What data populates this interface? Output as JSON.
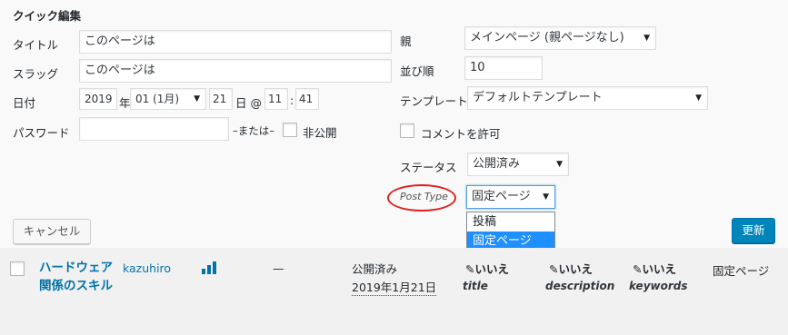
{
  "quick_edit": {
    "heading": "クイック編集",
    "title_label": "タイトル",
    "title_value": "このページは",
    "slug_label": "スラッグ",
    "slug_value": "このページは",
    "date_label": "日付",
    "year": "2019",
    "year_suffix": "年",
    "month": "01 (1月)",
    "day": "21",
    "day_suffix": "日 @",
    "hour": "11",
    "colon": ":",
    "minute": "41",
    "password_label": "パスワード",
    "password_value": "",
    "or_text": "–または–",
    "private_label": "非公開",
    "parent_label": "親",
    "parent_value": "メインページ (親ページなし)",
    "order_label": "並び順",
    "order_value": "10",
    "template_label": "テンプレート",
    "template_value": "デフォルトテンプレート",
    "comments_label": "コメントを許可",
    "status_label": "ステータス",
    "status_value": "公開済み",
    "post_type_label": "Post Type",
    "post_type_value": "固定ページ",
    "post_type_options": [
      "投稿",
      "固定ページ"
    ],
    "cancel_label": "キャンセル",
    "update_label": "更新",
    "annotation_color": "#e02020"
  },
  "row": {
    "title": "ハードウェア関係のスキル",
    "author": "kazuhiro",
    "dash": "—",
    "status": "公開済み",
    "date": "2019年1月21日",
    "col1_value": "いいえ",
    "col1_label": "title",
    "col2_value": "いいえ",
    "col2_label": "description",
    "col3_value": "いいえ",
    "col3_label": "keywords",
    "post_type": "固定ページ"
  },
  "colors": {
    "accent": "#0085ba",
    "link": "#0073aa",
    "highlight": "#1e90ff"
  }
}
